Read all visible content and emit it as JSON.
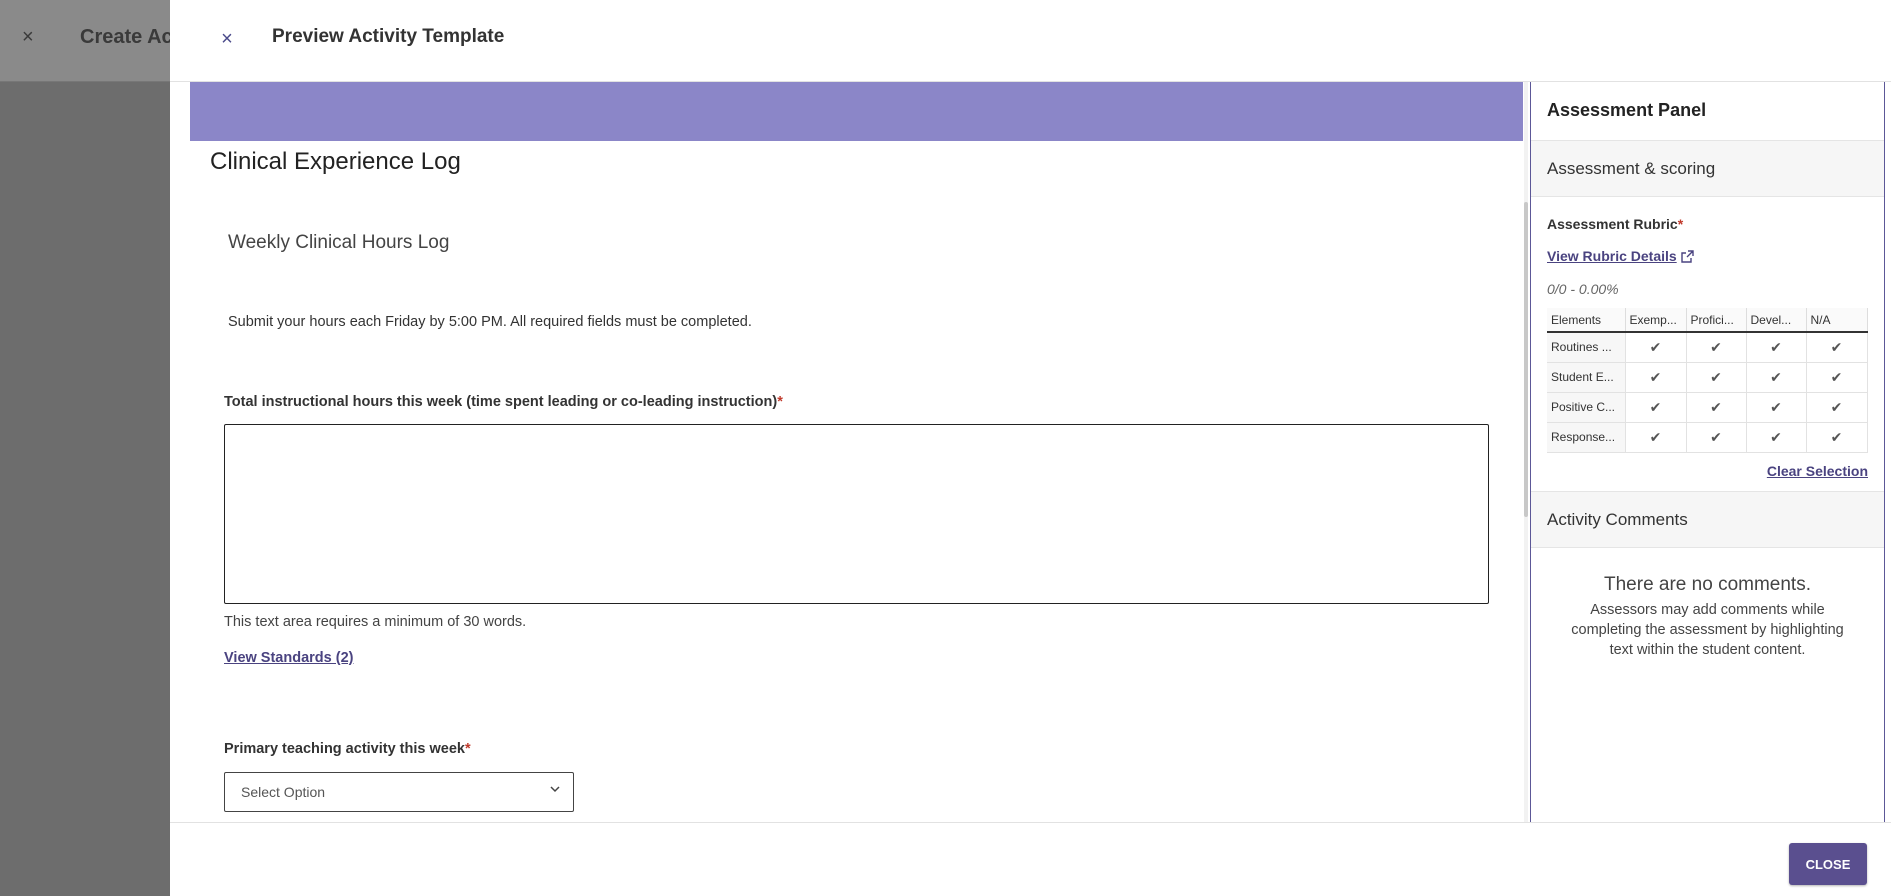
{
  "background": {
    "close_glyph": "×",
    "title": "Create Act"
  },
  "modal": {
    "close_glyph": "×",
    "title": "Preview Activity Template"
  },
  "content": {
    "doc_title": "Clinical Experience Log",
    "sub_title": "Weekly Clinical Hours Log",
    "instructions": "Submit your hours each Friday by 5:00 PM. All required fields must be completed.",
    "field1_label": "Total instructional hours this week (time spent leading or co-leading instruction)",
    "field1_required": "*",
    "field1_helper": "This text area requires a minimum of 30 words.",
    "standards_link": "View Standards (2)",
    "field2_label": "Primary teaching activity this week",
    "field2_required": "*",
    "select_placeholder": "Select Option"
  },
  "panel": {
    "title": "Assessment Panel",
    "section_scoring": "Assessment & scoring",
    "rubric_label": "Assessment Rubric",
    "rubric_required": "*",
    "rubric_link": "View Rubric Details",
    "score": "0/0 - 0.00%",
    "table": {
      "headers": [
        "Elements",
        "Exemp...",
        "Profici...",
        "Devel...",
        "N/A"
      ],
      "rows": [
        "Routines ...",
        "Student E...",
        "Positive C...",
        "Response..."
      ],
      "check_glyph": "✔"
    },
    "clear_selection": "Clear Selection",
    "section_comments": "Activity Comments",
    "no_comments_title": "There are no comments.",
    "no_comments_body": "Assessors may add comments while completing the assessment by highlighting text within the student content."
  },
  "footer": {
    "close_label": "CLOSE"
  },
  "colors": {
    "banner": "#8b86c8",
    "accent": "#5a4f8f",
    "link": "#4a4380",
    "required": "#c0392b"
  }
}
